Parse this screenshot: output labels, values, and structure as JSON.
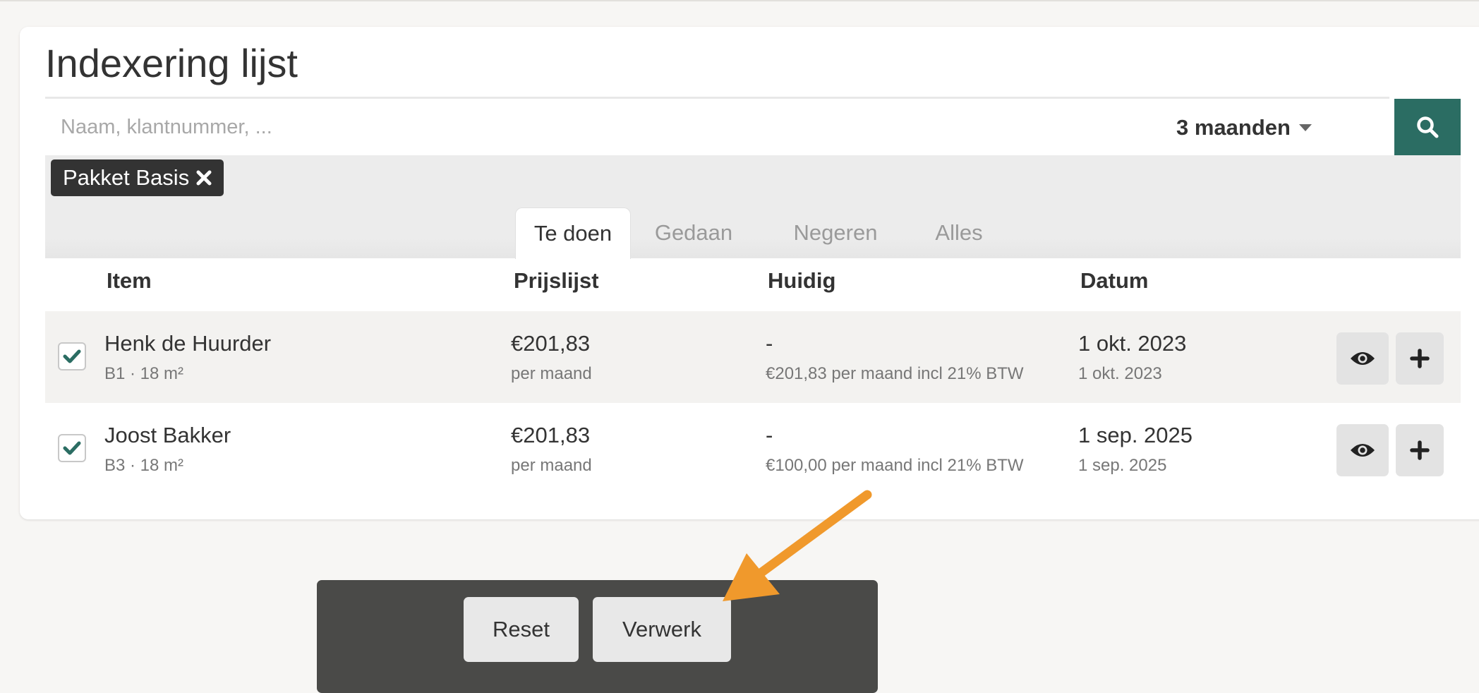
{
  "page": {
    "title": "Indexering lijst"
  },
  "search": {
    "placeholder": "Naam, klantnummer, ...",
    "value": ""
  },
  "period": {
    "label": "3 maanden"
  },
  "filter_chip": {
    "label": "Pakket Basis"
  },
  "tabs": [
    {
      "label": "Te doen",
      "active": true
    },
    {
      "label": "Gedaan",
      "active": false
    },
    {
      "label": "Negeren",
      "active": false
    },
    {
      "label": "Alles",
      "active": false
    }
  ],
  "table": {
    "headers": {
      "item": "Item",
      "pricelist": "Prijslijst",
      "current": "Huidig",
      "date": "Datum"
    },
    "rows": [
      {
        "checked": true,
        "name": "Henk de Huurder",
        "unit": "B1 · 18 m²",
        "price": "€201,83",
        "price_period": "per maand",
        "current": "-",
        "current_detail": "€201,83 per maand incl 21% BTW",
        "date": "1 okt. 2023",
        "date_sub": "1 okt. 2023"
      },
      {
        "checked": true,
        "name": "Joost Bakker",
        "unit": "B3 · 18 m²",
        "price": "€201,83",
        "price_period": "per maand",
        "current": "-",
        "current_detail": "€100,00 per maand incl 21% BTW",
        "date": "1 sep. 2025",
        "date_sub": "1 sep. 2025"
      }
    ]
  },
  "actions": {
    "reset_label": "Reset",
    "process_label": "Verwerk"
  },
  "icons": {
    "filter": "filter-icon",
    "search": "search-icon",
    "close": "close-icon",
    "view": "eye-icon",
    "add": "plus-icon",
    "check": "check-icon",
    "caret": "chevron-down-icon",
    "annotation_arrow": "arrow-icon"
  },
  "colors": {
    "accent": "#2b6d63",
    "chip_bg": "#333333",
    "action_bar_bg": "#4a4a48",
    "annotation_arrow": "#f0992c"
  }
}
